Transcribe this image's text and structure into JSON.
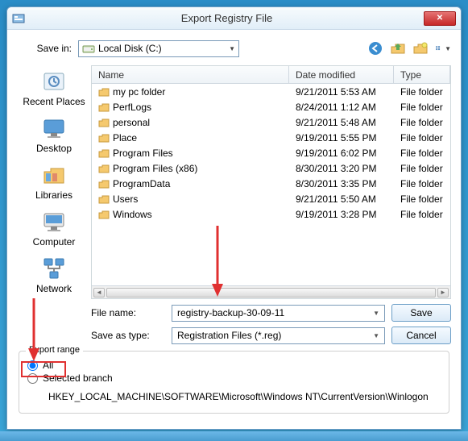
{
  "title": "Export Registry File",
  "save_in": {
    "label": "Save in:",
    "value": "Local Disk (C:)"
  },
  "columns": {
    "name": "Name",
    "date": "Date modified",
    "type": "Type"
  },
  "places": [
    {
      "label": "Recent Places",
      "key": "recent"
    },
    {
      "label": "Desktop",
      "key": "desktop"
    },
    {
      "label": "Libraries",
      "key": "libraries"
    },
    {
      "label": "Computer",
      "key": "computer"
    },
    {
      "label": "Network",
      "key": "network"
    }
  ],
  "files": [
    {
      "name": "my pc folder",
      "date": "9/21/2011 5:53 AM",
      "type": "File folder"
    },
    {
      "name": "PerfLogs",
      "date": "8/24/2011 1:12 AM",
      "type": "File folder"
    },
    {
      "name": "personal",
      "date": "9/21/2011 5:48 AM",
      "type": "File folder"
    },
    {
      "name": "Place",
      "date": "9/19/2011 5:55 PM",
      "type": "File folder"
    },
    {
      "name": "Program Files",
      "date": "9/19/2011 6:02 PM",
      "type": "File folder"
    },
    {
      "name": "Program Files (x86)",
      "date": "8/30/2011 3:20 PM",
      "type": "File folder"
    },
    {
      "name": "ProgramData",
      "date": "8/30/2011 3:35 PM",
      "type": "File folder"
    },
    {
      "name": "Users",
      "date": "9/21/2011 5:50 AM",
      "type": "File folder"
    },
    {
      "name": "Windows",
      "date": "9/19/2011 3:28 PM",
      "type": "File folder"
    }
  ],
  "file_name": {
    "label": "File name:",
    "value": "registry-backup-30-09-11"
  },
  "save_as_type": {
    "label": "Save as type:",
    "value": "Registration Files (*.reg)"
  },
  "buttons": {
    "save": "Save",
    "cancel": "Cancel"
  },
  "export_range": {
    "legend": "Export range",
    "all": "All",
    "selected": "Selected branch",
    "branch_path": "HKEY_LOCAL_MACHINE\\SOFTWARE\\Microsoft\\Windows NT\\CurrentVersion\\Winlogon"
  }
}
